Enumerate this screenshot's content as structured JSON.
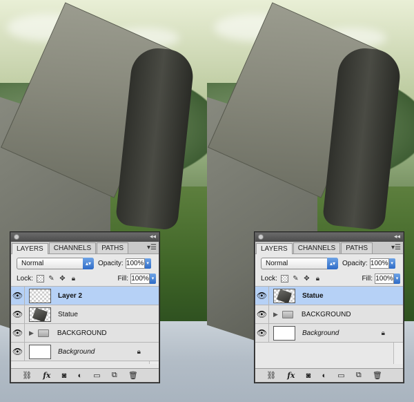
{
  "panels": [
    {
      "tabs": [
        "LAYERS",
        "CHANNELS",
        "PATHS"
      ],
      "blend_mode": "Normal",
      "opacity_label": "Opacity:",
      "opacity_value": "100%",
      "lock_label": "Lock:",
      "fill_label": "Fill:",
      "fill_value": "100%",
      "layers": [
        {
          "name": "Layer 2"
        },
        {
          "name": "Statue"
        },
        {
          "name": "BACKGROUND"
        },
        {
          "name": "Background"
        }
      ]
    },
    {
      "tabs": [
        "LAYERS",
        "CHANNELS",
        "PATHS"
      ],
      "blend_mode": "Normal",
      "opacity_label": "Opacity:",
      "opacity_value": "100%",
      "lock_label": "Lock:",
      "fill_label": "Fill:",
      "fill_value": "100%",
      "layers": [
        {
          "name": "Statue"
        },
        {
          "name": "BACKGROUND"
        },
        {
          "name": "Background"
        }
      ]
    }
  ],
  "icons": {
    "eye": "eye-icon",
    "link": "link-layers-icon",
    "fx": "fx",
    "mask": "add-mask-icon",
    "adjust": "adjustment-layer-icon",
    "group": "new-group-icon",
    "newlayer": "new-layer-icon",
    "trash": "trash-icon"
  },
  "colors": {
    "selected_row": "#b6d1f6",
    "accent": "#2e6bc7"
  }
}
